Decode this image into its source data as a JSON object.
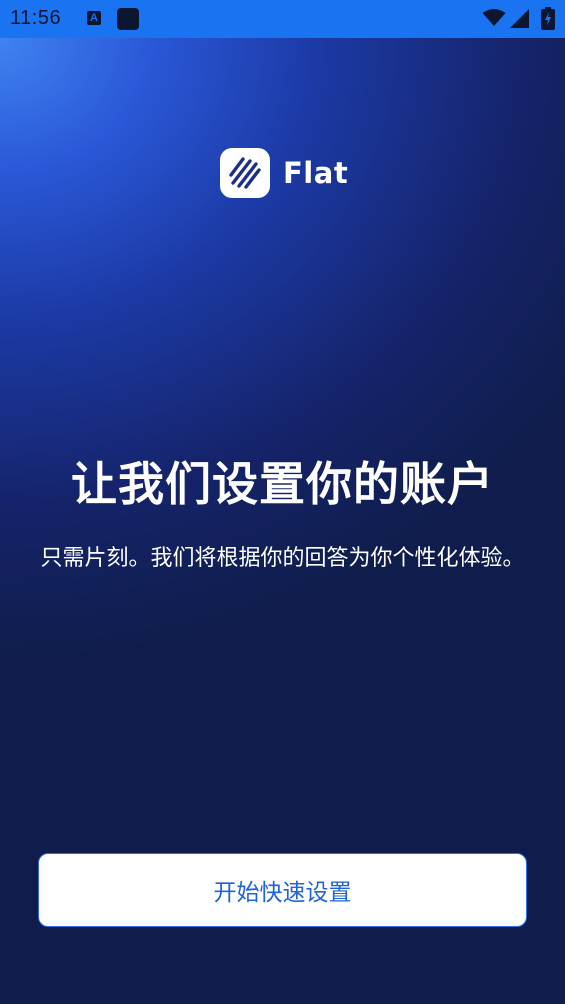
{
  "status_bar": {
    "time": "11:56",
    "notification_icon_letter": "A",
    "icons": [
      "notification-a-icon",
      "app-square-icon",
      "wifi-icon",
      "cell-signal-icon",
      "battery-icon"
    ]
  },
  "brand": {
    "name": "Flat",
    "logo_icon": "diagonal-stripes-logo-icon"
  },
  "main": {
    "title": "让我们设置你的账户",
    "subtitle": "只需片刻。我们将根据你的回答为你个性化体验。"
  },
  "actions": {
    "start_setup_label": "开始快速设置"
  },
  "colors": {
    "status_bar": "#1a73f0",
    "background_top": "#3f82f2",
    "background_bottom": "#101d4c",
    "button_text": "#1f63d8",
    "button_background": "#ffffff"
  }
}
